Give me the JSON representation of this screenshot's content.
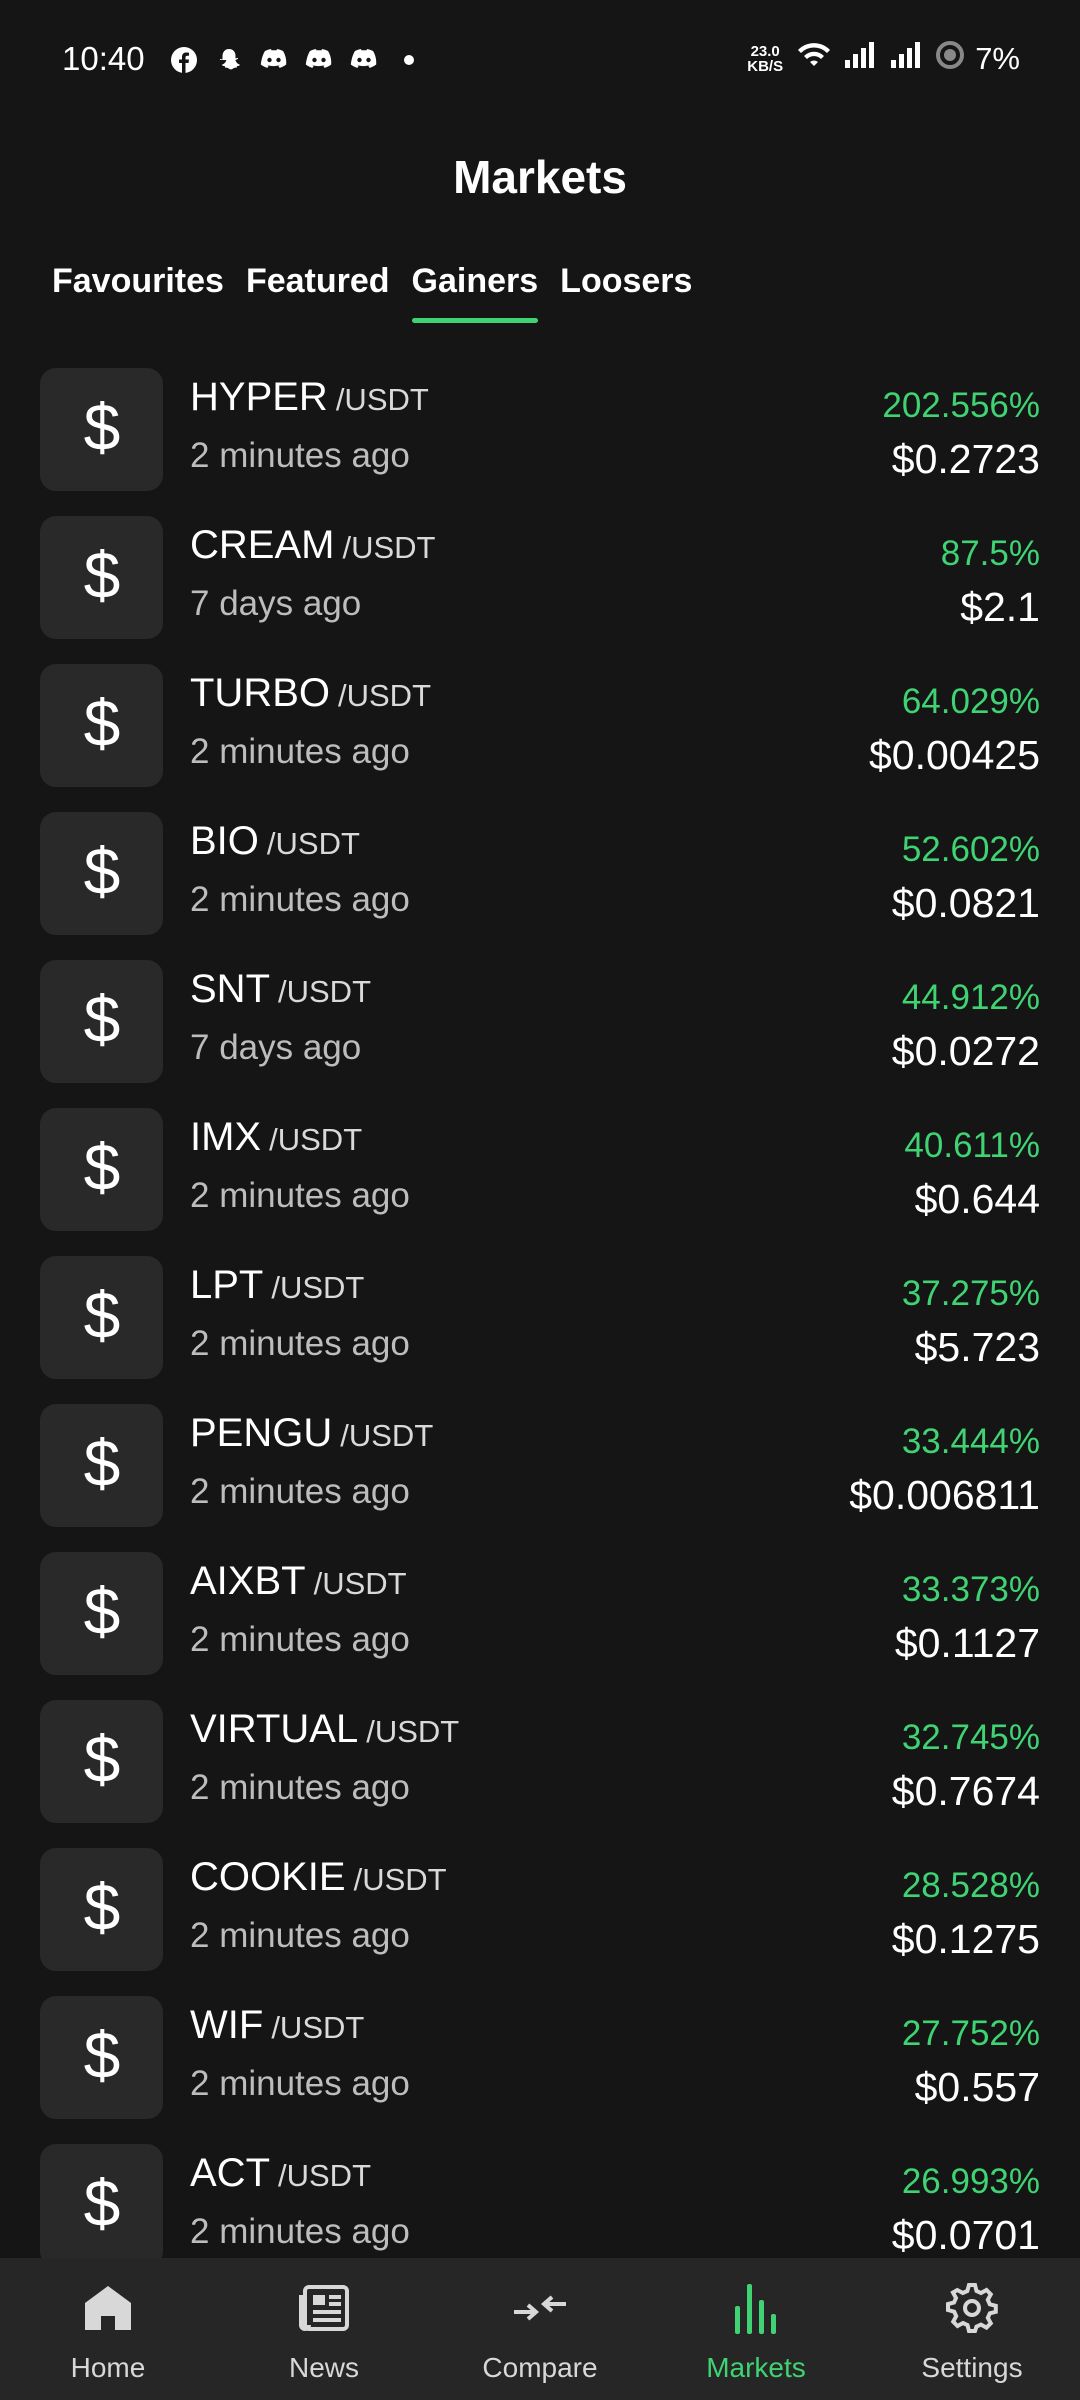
{
  "status_bar": {
    "time": "10:40",
    "left_icons": [
      "facebook-icon",
      "snapchat-icon",
      "discord-icon",
      "discord-icon",
      "discord-icon",
      "dot-icon"
    ],
    "net_speed_value": "23.0",
    "net_speed_unit": "KB/S",
    "battery": "7%"
  },
  "page_title": "Markets",
  "tabs": [
    {
      "label": "Favourites"
    },
    {
      "label": "Featured"
    },
    {
      "label": "Gainers"
    },
    {
      "label": "Loosers"
    }
  ],
  "active_tab": "Gainers",
  "coins": [
    {
      "icon": "dollar-icon",
      "symbol": "HYPER",
      "pair": "/USDT",
      "updated": "2 minutes ago",
      "change": "202.556%",
      "price": "$0.2723"
    },
    {
      "icon": "dollar-icon",
      "symbol": "CREAM",
      "pair": "/USDT",
      "updated": "7 days ago",
      "change": "87.5%",
      "price": "$2.1"
    },
    {
      "icon": "dollar-icon",
      "symbol": "TURBO",
      "pair": "/USDT",
      "updated": "2 minutes ago",
      "change": "64.029%",
      "price": "$0.00425"
    },
    {
      "icon": "dollar-icon",
      "symbol": "BIO",
      "pair": "/USDT",
      "updated": "2 minutes ago",
      "change": "52.602%",
      "price": "$0.0821"
    },
    {
      "icon": "dollar-icon",
      "symbol": "SNT",
      "pair": "/USDT",
      "updated": "7 days ago",
      "change": "44.912%",
      "price": "$0.0272"
    },
    {
      "icon": "dollar-icon",
      "symbol": "IMX",
      "pair": "/USDT",
      "updated": "2 minutes ago",
      "change": "40.611%",
      "price": "$0.644"
    },
    {
      "icon": "dollar-icon",
      "symbol": "LPT",
      "pair": "/USDT",
      "updated": "2 minutes ago",
      "change": "37.275%",
      "price": "$5.723"
    },
    {
      "icon": "dollar-icon",
      "symbol": "PENGU",
      "pair": "/USDT",
      "updated": "2 minutes ago",
      "change": "33.444%",
      "price": "$0.006811"
    },
    {
      "icon": "dollar-icon",
      "symbol": "AIXBT",
      "pair": "/USDT",
      "updated": "2 minutes ago",
      "change": "33.373%",
      "price": "$0.1127"
    },
    {
      "icon": "dollar-icon",
      "symbol": "VIRTUAL",
      "pair": "/USDT",
      "updated": "2 minutes ago",
      "change": "32.745%",
      "price": "$0.7674"
    },
    {
      "icon": "dollar-icon",
      "symbol": "COOKIE",
      "pair": "/USDT",
      "updated": "2 minutes ago",
      "change": "28.528%",
      "price": "$0.1275"
    },
    {
      "icon": "dollar-icon",
      "symbol": "WIF",
      "pair": "/USDT",
      "updated": "2 minutes ago",
      "change": "27.752%",
      "price": "$0.557"
    },
    {
      "icon": "dollar-icon",
      "symbol": "ACT",
      "pair": "/USDT",
      "updated": "2 minutes ago",
      "change": "26.993%",
      "price": "$0.0701"
    }
  ],
  "bottom_nav": [
    {
      "label": "Home",
      "icon": "home-icon"
    },
    {
      "label": "News",
      "icon": "news-icon"
    },
    {
      "label": "Compare",
      "icon": "compare-icon"
    },
    {
      "label": "Markets",
      "icon": "markets-icon"
    },
    {
      "label": "Settings",
      "icon": "settings-icon"
    }
  ],
  "active_nav": "Markets",
  "colors": {
    "background": "#151515",
    "card": "#292929",
    "accent_green": "#3fd373",
    "nav_background": "#262626"
  }
}
